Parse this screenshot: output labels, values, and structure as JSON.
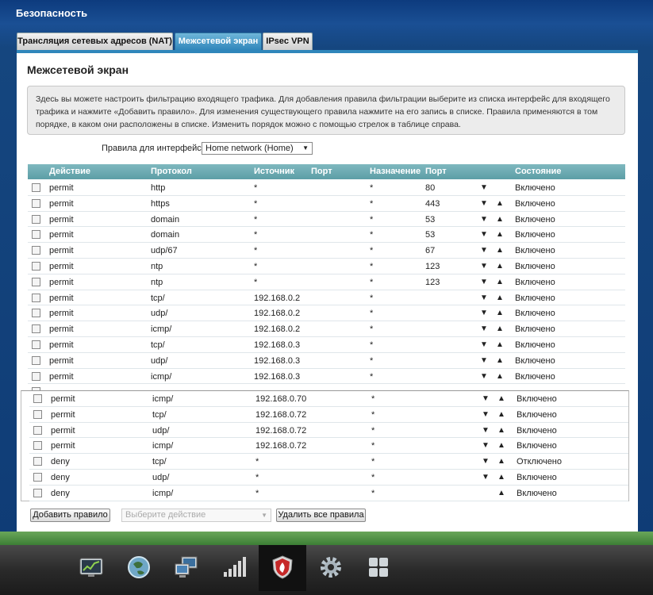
{
  "header": {
    "title": "Безопасность"
  },
  "tabs": [
    {
      "label": "Трансляция сетевых адресов (NAT)"
    },
    {
      "label": "Межсетевой экран"
    },
    {
      "label": "IPsec VPN"
    }
  ],
  "page": {
    "title": "Межсетевой экран",
    "info": "Здесь вы можете настроить фильтрацию входящего трафика. Для добавления правила фильтрации выберите из списка интерфейс для входящего трафика и нажмите «Добавить правило». Для изменения существующего правила нажмите на его запись в списке. Правила применяются в том порядке, в каком они расположены в списке. Изменить порядок можно с помощью стрелок в таблице справа.",
    "iface_label": "Правила для интерфейса:",
    "iface_value": "Home network (Home)"
  },
  "table": {
    "headers": {
      "action": "Действие",
      "protocol": "Протокол",
      "source": "Источник",
      "sport": "Порт",
      "dest": "Назначение",
      "dport": "Порт",
      "state": "Состояние"
    },
    "rows": [
      {
        "action": "permit",
        "protocol": "http",
        "source": "*",
        "dest": "*",
        "dport": "80",
        "state": "Включено"
      },
      {
        "action": "permit",
        "protocol": "https",
        "source": "*",
        "dest": "*",
        "dport": "443",
        "state": "Включено"
      },
      {
        "action": "permit",
        "protocol": "domain",
        "source": "*",
        "dest": "*",
        "dport": "53",
        "state": "Включено"
      },
      {
        "action": "permit",
        "protocol": "domain",
        "source": "*",
        "dest": "*",
        "dport": "53",
        "state": "Включено"
      },
      {
        "action": "permit",
        "protocol": "udp/67",
        "source": "*",
        "dest": "*",
        "dport": "67",
        "state": "Включено"
      },
      {
        "action": "permit",
        "protocol": "ntp",
        "source": "*",
        "dest": "*",
        "dport": "123",
        "state": "Включено"
      },
      {
        "action": "permit",
        "protocol": "ntp",
        "source": "*",
        "dest": "*",
        "dport": "123",
        "state": "Включено"
      },
      {
        "action": "permit",
        "protocol": "tcp/",
        "source": "192.168.0.2",
        "dest": "*",
        "dport": "",
        "state": "Включено"
      },
      {
        "action": "permit",
        "protocol": "udp/",
        "source": "192.168.0.2",
        "dest": "*",
        "dport": "",
        "state": "Включено"
      },
      {
        "action": "permit",
        "protocol": "icmp/",
        "source": "192.168.0.2",
        "dest": "*",
        "dport": "",
        "state": "Включено"
      },
      {
        "action": "permit",
        "protocol": "tcp/",
        "source": "192.168.0.3",
        "dest": "*",
        "dport": "",
        "state": "Включено"
      },
      {
        "action": "permit",
        "protocol": "udp/",
        "source": "192.168.0.3",
        "dest": "*",
        "dport": "",
        "state": "Включено"
      },
      {
        "action": "permit",
        "protocol": "icmp/",
        "source": "192.168.0.3",
        "dest": "*",
        "dport": "",
        "state": "Включено"
      }
    ],
    "lower_rows": [
      {
        "action": "permit",
        "protocol": "icmp/",
        "source": "192.168.0.70",
        "dest": "*",
        "state": "Включено"
      },
      {
        "action": "permit",
        "protocol": "tcp/",
        "source": "192.168.0.72",
        "dest": "*",
        "state": "Включено"
      },
      {
        "action": "permit",
        "protocol": "udp/",
        "source": "192.168.0.72",
        "dest": "*",
        "state": "Включено"
      },
      {
        "action": "permit",
        "protocol": "icmp/",
        "source": "192.168.0.72",
        "dest": "*",
        "state": "Включено"
      },
      {
        "action": "deny",
        "protocol": "tcp/",
        "source": "*",
        "dest": "*",
        "state": "Отключено"
      },
      {
        "action": "deny",
        "protocol": "udp/",
        "source": "*",
        "dest": "*",
        "state": "Включено"
      },
      {
        "action": "deny",
        "protocol": "icmp/",
        "source": "*",
        "dest": "*",
        "state": "Включено"
      }
    ]
  },
  "buttons": {
    "add": "Добавить правило",
    "action_placeholder": "Выберите действие",
    "delete_all": "Удалить все правила"
  },
  "taskbar": [
    {
      "icon": "monitor-chart-icon"
    },
    {
      "icon": "globe-icon"
    },
    {
      "icon": "computers-network-icon"
    },
    {
      "icon": "signal-bars-icon"
    },
    {
      "icon": "firewall-shield-icon",
      "active": true
    },
    {
      "icon": "gear-icon"
    },
    {
      "icon": "apps-grid-icon"
    }
  ]
}
